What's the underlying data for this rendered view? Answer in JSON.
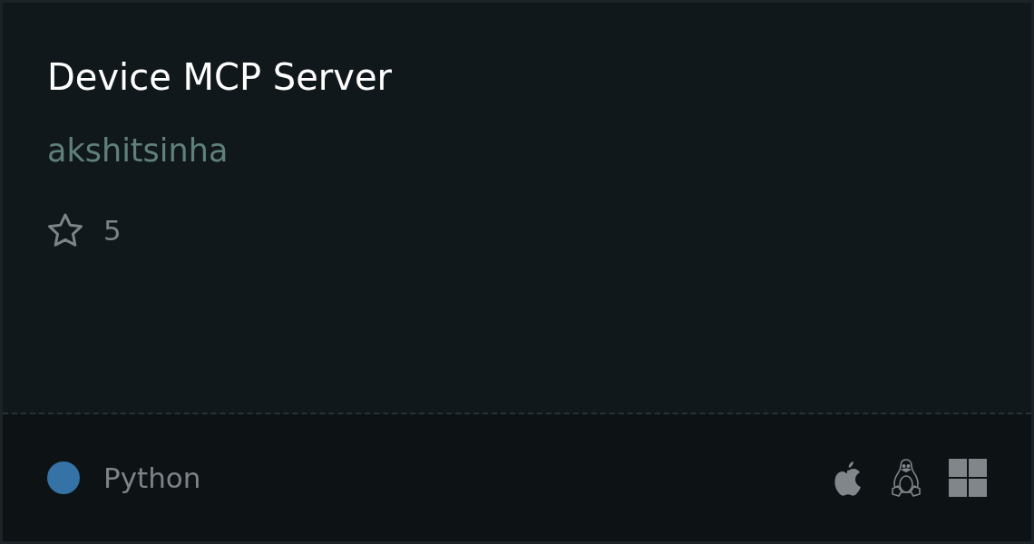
{
  "card": {
    "title": "Device MCP Server",
    "author": "akshitsinha",
    "star_count": "5"
  },
  "footer": {
    "language": {
      "name": "Python",
      "color": "#3572a5"
    },
    "platforms": [
      {
        "kind": "apple"
      },
      {
        "kind": "linux"
      },
      {
        "kind": "windows"
      }
    ]
  }
}
